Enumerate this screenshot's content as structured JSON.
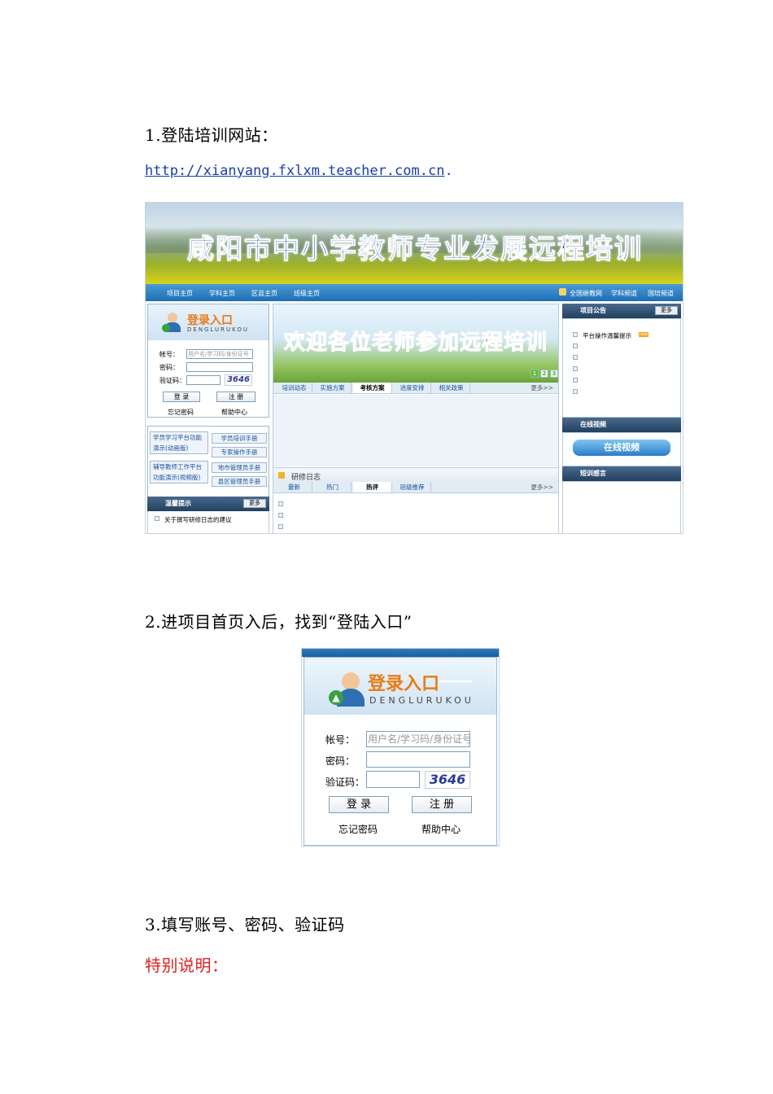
{
  "doc": {
    "step1_title": "1.登陆培训网站：",
    "url": "http://xianyang.fxlxm.teacher.com.cn",
    "url_period": ".",
    "step2_title": "2.进项目首页入后，找到“登陆入口”",
    "step3_title": "3.填写账号、密码、验证码",
    "note_title": "特别说明："
  },
  "site": {
    "banner_title": "咸阳市中小学教师专业发展远程培训",
    "nav_left": [
      "项目主页",
      "学科主页",
      "区县主页",
      "班级主页"
    ],
    "nav_right": [
      "全国继教网",
      "学科频道",
      "国培频道"
    ],
    "welcome_text": "欢迎各位老师参加远程培训",
    "pages": [
      "1",
      "2",
      "3"
    ],
    "tabs1": [
      "培训动态",
      "实施方案",
      "考核方案",
      "进度安排",
      "相关政策"
    ],
    "tabs1_more": "更多>>",
    "diary_title": "研修日志",
    "tabs2": [
      "最新",
      "热门",
      "热评",
      "班级推荐"
    ],
    "tabs2_more": "更多>>",
    "guide": {
      "left1": "学员学习平台功能演示(动画版)",
      "left2": "辅导教师工作平台功能演示(视频版)",
      "buttons": [
        "学员培训手册",
        "专家操作手册",
        "地市管理员手册",
        "县区管理员手册"
      ]
    },
    "tips_title": "温馨提示",
    "tips_more": "更多",
    "tips_item": "关于撰写研修日志的建议",
    "notice_title": "项目公告",
    "notice_more": "更多",
    "notice_item": "平台操作温馨提示",
    "notice_new": "new",
    "video_title": "在线视频",
    "video_btn": "在线视频",
    "message_title": "短训感言"
  },
  "login": {
    "title": "登录入口",
    "subtitle": "DENGLURUKOU",
    "account_label": "帐号：",
    "account_placeholder": "用户名/学习码/身份证号",
    "password_label": "密码：",
    "captcha_label": "验证码：",
    "captcha_value": "3646",
    "login_btn": "登 录",
    "register_btn": "注 册",
    "forgot": "忘记密码",
    "help": "帮助中心"
  },
  "colors": {
    "link": "#1a3ea8",
    "note_red": "#e02020",
    "nav_blue": "#1c6eb5",
    "login_orange": "#e97a14"
  }
}
